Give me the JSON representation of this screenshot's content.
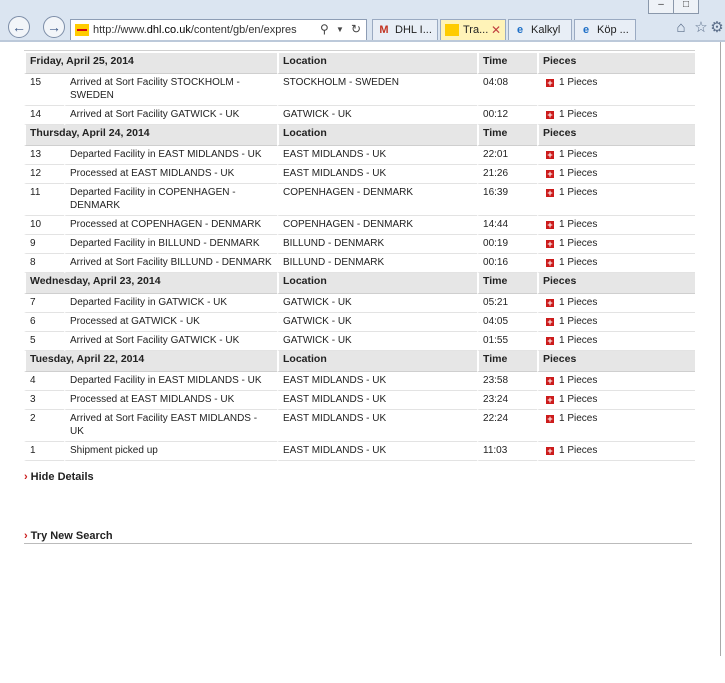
{
  "browser": {
    "url_prefix": "http://www.",
    "url_domain": "dhl.co.uk",
    "url_rest": "/content/gb/en/expres",
    "tabs": [
      {
        "label": "DHL I...",
        "icon": "gmail-icon",
        "active": false
      },
      {
        "label": "Tra...",
        "icon": "dhl-icon",
        "active": true
      },
      {
        "label": "Kalkyl",
        "icon": "ie-icon",
        "active": false
      },
      {
        "label": "Köp ...",
        "icon": "ie-icon",
        "active": false
      }
    ],
    "window_controls": [
      "–",
      "□"
    ],
    "toolbar_icons": [
      "home-icon",
      "favorites-star-icon",
      "tools-gear-icon"
    ]
  },
  "tracking": {
    "col_location": "Location",
    "col_time": "Time",
    "col_pieces": "Pieces",
    "days": [
      {
        "date": "Friday, April 25, 2014",
        "events": [
          {
            "num": "15",
            "desc": "Arrived at Sort Facility STOCKHOLM - SWEDEN",
            "location": "STOCKHOLM - SWEDEN",
            "time": "04:08",
            "pieces": "1 Pieces"
          },
          {
            "num": "14",
            "desc": "Arrived at Sort Facility GATWICK - UK",
            "location": "GATWICK - UK",
            "time": "00:12",
            "pieces": "1 Pieces"
          }
        ]
      },
      {
        "date": "Thursday, April 24, 2014",
        "events": [
          {
            "num": "13",
            "desc": "Departed Facility in EAST MIDLANDS - UK",
            "location": "EAST MIDLANDS - UK",
            "time": "22:01",
            "pieces": "1 Pieces"
          },
          {
            "num": "12",
            "desc": "Processed at EAST MIDLANDS - UK",
            "location": "EAST MIDLANDS - UK",
            "time": "21:26",
            "pieces": "1 Pieces"
          },
          {
            "num": "11",
            "desc": "Departed Facility in COPENHAGEN - DENMARK",
            "location": "COPENHAGEN - DENMARK",
            "time": "16:39",
            "pieces": "1 Pieces"
          },
          {
            "num": "10",
            "desc": "Processed at COPENHAGEN - DENMARK",
            "location": "COPENHAGEN - DENMARK",
            "time": "14:44",
            "pieces": "1 Pieces"
          },
          {
            "num": "9",
            "desc": "Departed Facility in BILLUND - DENMARK",
            "location": "BILLUND - DENMARK",
            "time": "00:19",
            "pieces": "1 Pieces"
          },
          {
            "num": "8",
            "desc": "Arrived at Sort Facility BILLUND - DENMARK",
            "location": "BILLUND - DENMARK",
            "time": "00:16",
            "pieces": "1 Pieces"
          }
        ]
      },
      {
        "date": "Wednesday, April 23, 2014",
        "events": [
          {
            "num": "7",
            "desc": "Departed Facility in GATWICK - UK",
            "location": "GATWICK - UK",
            "time": "05:21",
            "pieces": "1 Pieces"
          },
          {
            "num": "6",
            "desc": "Processed at GATWICK - UK",
            "location": "GATWICK - UK",
            "time": "04:05",
            "pieces": "1 Pieces"
          },
          {
            "num": "5",
            "desc": "Arrived at Sort Facility GATWICK - UK",
            "location": "GATWICK - UK",
            "time": "01:55",
            "pieces": "1 Pieces"
          }
        ]
      },
      {
        "date": "Tuesday, April 22, 2014",
        "events": [
          {
            "num": "4",
            "desc": "Departed Facility in EAST MIDLANDS - UK",
            "location": "EAST MIDLANDS - UK",
            "time": "23:58",
            "pieces": "1 Pieces"
          },
          {
            "num": "3",
            "desc": "Processed at EAST MIDLANDS - UK",
            "location": "EAST MIDLANDS - UK",
            "time": "23:24",
            "pieces": "1 Pieces"
          },
          {
            "num": "2",
            "desc": "Arrived at Sort Facility EAST MIDLANDS - UK",
            "location": "EAST MIDLANDS - UK",
            "time": "22:24",
            "pieces": "1 Pieces"
          },
          {
            "num": "1",
            "desc": "Shipment picked up",
            "location": "EAST MIDLANDS - UK",
            "time": "11:03",
            "pieces": "1 Pieces"
          }
        ]
      }
    ]
  },
  "links": {
    "arrow": "›",
    "hide_details": "Hide Details",
    "try_new_search": "Try New Search"
  },
  "colors": {
    "accent_red": "#cc1b1b",
    "header_gray": "#e6e6e6",
    "dhl_yellow": "#ffcc00"
  }
}
